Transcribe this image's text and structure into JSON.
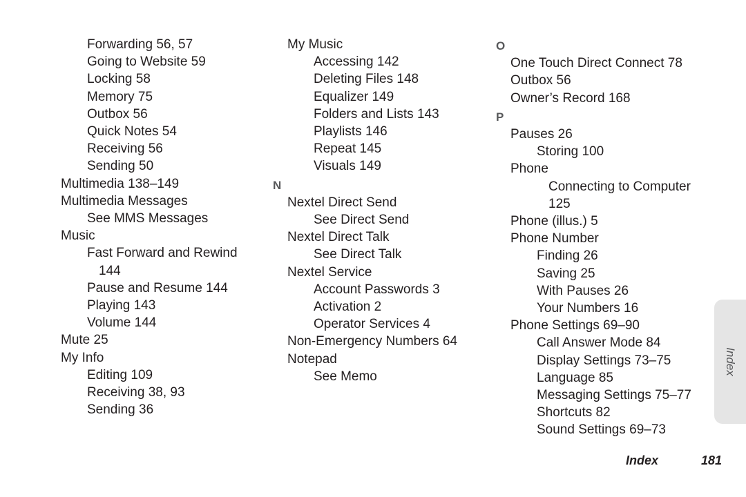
{
  "document": {
    "type": "index",
    "side_tab_label": "Index",
    "footer": {
      "label": "Index",
      "page_number": "181"
    },
    "colors": {
      "text": "#231f20",
      "letter_heading": "#58595b",
      "side_tab_background": "#e5e5e5",
      "page_background": "#ffffff"
    }
  },
  "columns": [
    {
      "id": "column-1",
      "lines": [
        {
          "kind": "entry",
          "level": 1,
          "text": "Forwarding 56, 57"
        },
        {
          "kind": "entry",
          "level": 1,
          "text": "Going to Website 59"
        },
        {
          "kind": "entry",
          "level": 1,
          "text": "Locking 58"
        },
        {
          "kind": "entry",
          "level": 1,
          "text": "Memory 75"
        },
        {
          "kind": "entry",
          "level": 1,
          "text": "Outbox 56"
        },
        {
          "kind": "entry",
          "level": 1,
          "text": "Quick Notes 54"
        },
        {
          "kind": "entry",
          "level": 1,
          "text": "Receiving 56"
        },
        {
          "kind": "entry",
          "level": 1,
          "text": "Sending 50"
        },
        {
          "kind": "entry",
          "level": 0,
          "text": "Multimedia 138–149"
        },
        {
          "kind": "entry",
          "level": 0,
          "text": "Multimedia Messages"
        },
        {
          "kind": "entry",
          "level": 1,
          "text": "See MMS Messages"
        },
        {
          "kind": "entry",
          "level": 0,
          "text": "Music"
        },
        {
          "kind": "entry",
          "level": 1,
          "text": "Fast Forward and Rewind"
        },
        {
          "kind": "entry",
          "level": 2,
          "text": "144"
        },
        {
          "kind": "entry",
          "level": 1,
          "text": "Pause and Resume 144"
        },
        {
          "kind": "entry",
          "level": 1,
          "text": "Playing 143"
        },
        {
          "kind": "entry",
          "level": 1,
          "text": "Volume 144"
        },
        {
          "kind": "entry",
          "level": 0,
          "text": "Mute 25"
        },
        {
          "kind": "entry",
          "level": 0,
          "text": "My Info"
        },
        {
          "kind": "entry",
          "level": 1,
          "text": "Editing 109"
        },
        {
          "kind": "entry",
          "level": 1,
          "text": "Receiving 38, 93"
        },
        {
          "kind": "entry",
          "level": 1,
          "text": "Sending 36"
        }
      ]
    },
    {
      "id": "column-2",
      "lines": [
        {
          "kind": "entry",
          "level": 0,
          "text": "My Music"
        },
        {
          "kind": "entry",
          "level": 1,
          "text": "Accessing 142"
        },
        {
          "kind": "entry",
          "level": 1,
          "text": "Deleting Files 148"
        },
        {
          "kind": "entry",
          "level": 1,
          "text": "Equalizer 149"
        },
        {
          "kind": "entry",
          "level": 1,
          "text": "Folders and Lists 143"
        },
        {
          "kind": "entry",
          "level": 1,
          "text": "Playlists 146"
        },
        {
          "kind": "entry",
          "level": 1,
          "text": "Repeat 145"
        },
        {
          "kind": "entry",
          "level": 1,
          "text": "Visuals 149"
        },
        {
          "kind": "letter",
          "level": 0,
          "text": "N"
        },
        {
          "kind": "entry",
          "level": 0,
          "text": "Nextel Direct Send"
        },
        {
          "kind": "entry",
          "level": 1,
          "text": "See Direct Send"
        },
        {
          "kind": "entry",
          "level": 0,
          "text": "Nextel Direct Talk"
        },
        {
          "kind": "entry",
          "level": 1,
          "text": "See Direct Talk"
        },
        {
          "kind": "entry",
          "level": 0,
          "text": "Nextel Service"
        },
        {
          "kind": "entry",
          "level": 1,
          "text": "Account Passwords 3"
        },
        {
          "kind": "entry",
          "level": 1,
          "text": "Activation 2"
        },
        {
          "kind": "entry",
          "level": 1,
          "text": "Operator Services 4"
        },
        {
          "kind": "entry",
          "level": 0,
          "text": "Non-Emergency Numbers 64"
        },
        {
          "kind": "entry",
          "level": 0,
          "text": "Notepad"
        },
        {
          "kind": "entry",
          "level": 1,
          "text": "See Memo"
        }
      ]
    },
    {
      "id": "column-3",
      "lines": [
        {
          "kind": "letter",
          "level": 0,
          "text": "O"
        },
        {
          "kind": "entry",
          "level": 0,
          "text": "One Touch Direct Connect 78"
        },
        {
          "kind": "entry",
          "level": 0,
          "text": "Outbox 56"
        },
        {
          "kind": "entry",
          "level": 0,
          "text": "Owner’s Record 168"
        },
        {
          "kind": "letter",
          "level": 0,
          "text": "P"
        },
        {
          "kind": "entry",
          "level": 0,
          "text": "Pauses 26"
        },
        {
          "kind": "entry",
          "level": 1,
          "text": "Storing 100"
        },
        {
          "kind": "entry",
          "level": 0,
          "text": "Phone"
        },
        {
          "kind": "entry",
          "level": 2,
          "text": "Connecting to Computer 125"
        },
        {
          "kind": "entry",
          "level": 0,
          "text": "Phone (illus.) 5"
        },
        {
          "kind": "entry",
          "level": 0,
          "text": "Phone Number"
        },
        {
          "kind": "entry",
          "level": 1,
          "text": "Finding 26"
        },
        {
          "kind": "entry",
          "level": 1,
          "text": "Saving 25"
        },
        {
          "kind": "entry",
          "level": 1,
          "text": "With Pauses 26"
        },
        {
          "kind": "entry",
          "level": 1,
          "text": "Your Numbers 16"
        },
        {
          "kind": "entry",
          "level": 0,
          "text": "Phone Settings 69–90"
        },
        {
          "kind": "entry",
          "level": 1,
          "text": "Call Answer Mode 84"
        },
        {
          "kind": "entry",
          "level": 1,
          "text": "Display Settings 73–75"
        },
        {
          "kind": "entry",
          "level": 1,
          "text": "Language 85"
        },
        {
          "kind": "entry",
          "level": 1,
          "text": "Messaging Settings 75–77"
        },
        {
          "kind": "entry",
          "level": 1,
          "text": "Shortcuts 82"
        },
        {
          "kind": "entry",
          "level": 1,
          "text": "Sound Settings 69–73"
        }
      ]
    }
  ]
}
